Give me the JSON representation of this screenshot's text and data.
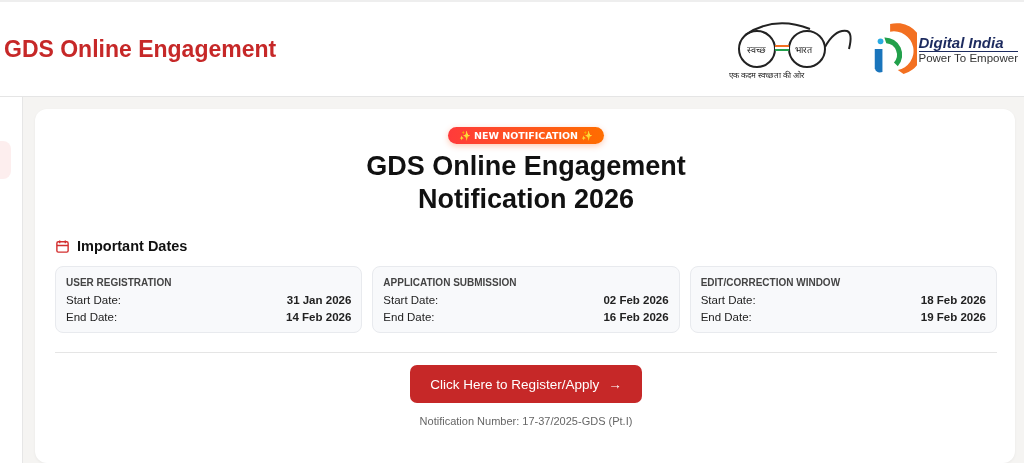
{
  "header": {
    "title": "GDS Online Engagement",
    "swachh_logo": {
      "left": "स्वच्छ",
      "right": "भारत",
      "tagline": "एक कदम स्वच्छता की ओर"
    },
    "digital_logo": {
      "name": "Digital India",
      "tagline": "Power To Empower"
    }
  },
  "card": {
    "badge": "✨ NEW NOTIFICATION ✨",
    "title_lines": [
      "GDS Online Engagement",
      "Notification 2026"
    ],
    "section_title": "Important Dates",
    "date_boxes": [
      {
        "title": "USER REGISTRATION",
        "rows": [
          {
            "label": "Start Date:",
            "value": "31 Jan 2026"
          },
          {
            "label": "End Date:",
            "value": "14 Feb 2026"
          }
        ]
      },
      {
        "title": "APPLICATION SUBMISSION",
        "rows": [
          {
            "label": "Start Date:",
            "value": "02 Feb 2026"
          },
          {
            "label": "End Date:",
            "value": "16 Feb 2026"
          }
        ]
      },
      {
        "title": "EDIT/CORRECTION WINDOW",
        "rows": [
          {
            "label": "Start Date:",
            "value": "18 Feb 2026"
          },
          {
            "label": "End Date:",
            "value": "19 Feb 2026"
          }
        ]
      }
    ],
    "button": "Click Here to Register/Apply",
    "arrow": "→",
    "note": "Notification Number: 17-37/2025-GDS (Pt.I)"
  }
}
